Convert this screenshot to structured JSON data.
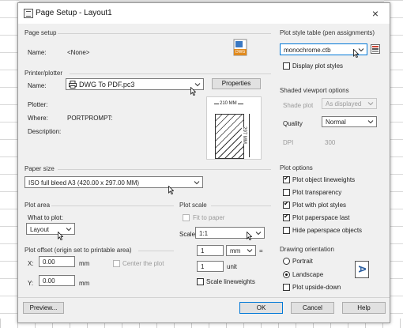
{
  "window": {
    "title": "Page Setup - Layout1"
  },
  "page_setup": {
    "header": "Page setup",
    "name_label": "Name:",
    "name_value": "<None>",
    "dwg_icon_text": "DWG"
  },
  "printer": {
    "header": "Printer/plotter",
    "name_label": "Name:",
    "name_value": "DWG To PDF.pc3",
    "properties_label": "Properties",
    "plotter_label": "Plotter:",
    "where_label": "Where:",
    "where_value": "PORTPROMPT:",
    "description_label": "Description:",
    "preview_width": "210 MM",
    "preview_height": "297 MM"
  },
  "paper_size": {
    "header": "Paper size",
    "value": "ISO full bleed A3 (420.00 x 297.00 MM)"
  },
  "plot_area": {
    "header": "Plot area",
    "what_label": "What to plot:",
    "value": "Layout"
  },
  "plot_offset": {
    "header": "Plot offset (origin set to printable area)",
    "x_label": "X:",
    "x_value": "0.00",
    "y_label": "Y:",
    "y_value": "0.00",
    "unit": "mm",
    "center_label": "Center the plot"
  },
  "plot_scale": {
    "header": "Plot scale",
    "fit_label": "Fit to paper",
    "scale_label": "Scale:",
    "scale_value": "1:1",
    "num_value": "1",
    "num_unit": "mm",
    "equals": "=",
    "den_value": "1",
    "den_unit": "unit",
    "lineweights_label": "Scale lineweights"
  },
  "plot_style": {
    "header": "Plot style table (pen assignments)",
    "value": "monochrome.ctb",
    "display_label": "Display plot styles"
  },
  "shaded": {
    "header": "Shaded viewport options",
    "shade_label": "Shade plot",
    "shade_value": "As displayed",
    "quality_label": "Quality",
    "quality_value": "Normal",
    "dpi_label": "DPI",
    "dpi_value": "300"
  },
  "plot_options": {
    "header": "Plot options",
    "items": [
      {
        "label": "Plot object lineweights",
        "checked": true
      },
      {
        "label": "Plot transparency",
        "checked": false
      },
      {
        "label": "Plot with plot styles",
        "checked": true
      },
      {
        "label": "Plot paperspace last",
        "checked": true
      },
      {
        "label": "Hide paperspace objects",
        "checked": false
      }
    ]
  },
  "orientation": {
    "header": "Drawing orientation",
    "portrait_label": "Portrait",
    "landscape_label": "Landscape",
    "upside_label": "Plot upside-down",
    "selected": "Landscape",
    "orient_glyph": "A"
  },
  "footer": {
    "preview_label": "Preview...",
    "ok_label": "OK",
    "cancel_label": "Cancel",
    "help_label": "Help"
  },
  "icons": {
    "close": "×"
  }
}
